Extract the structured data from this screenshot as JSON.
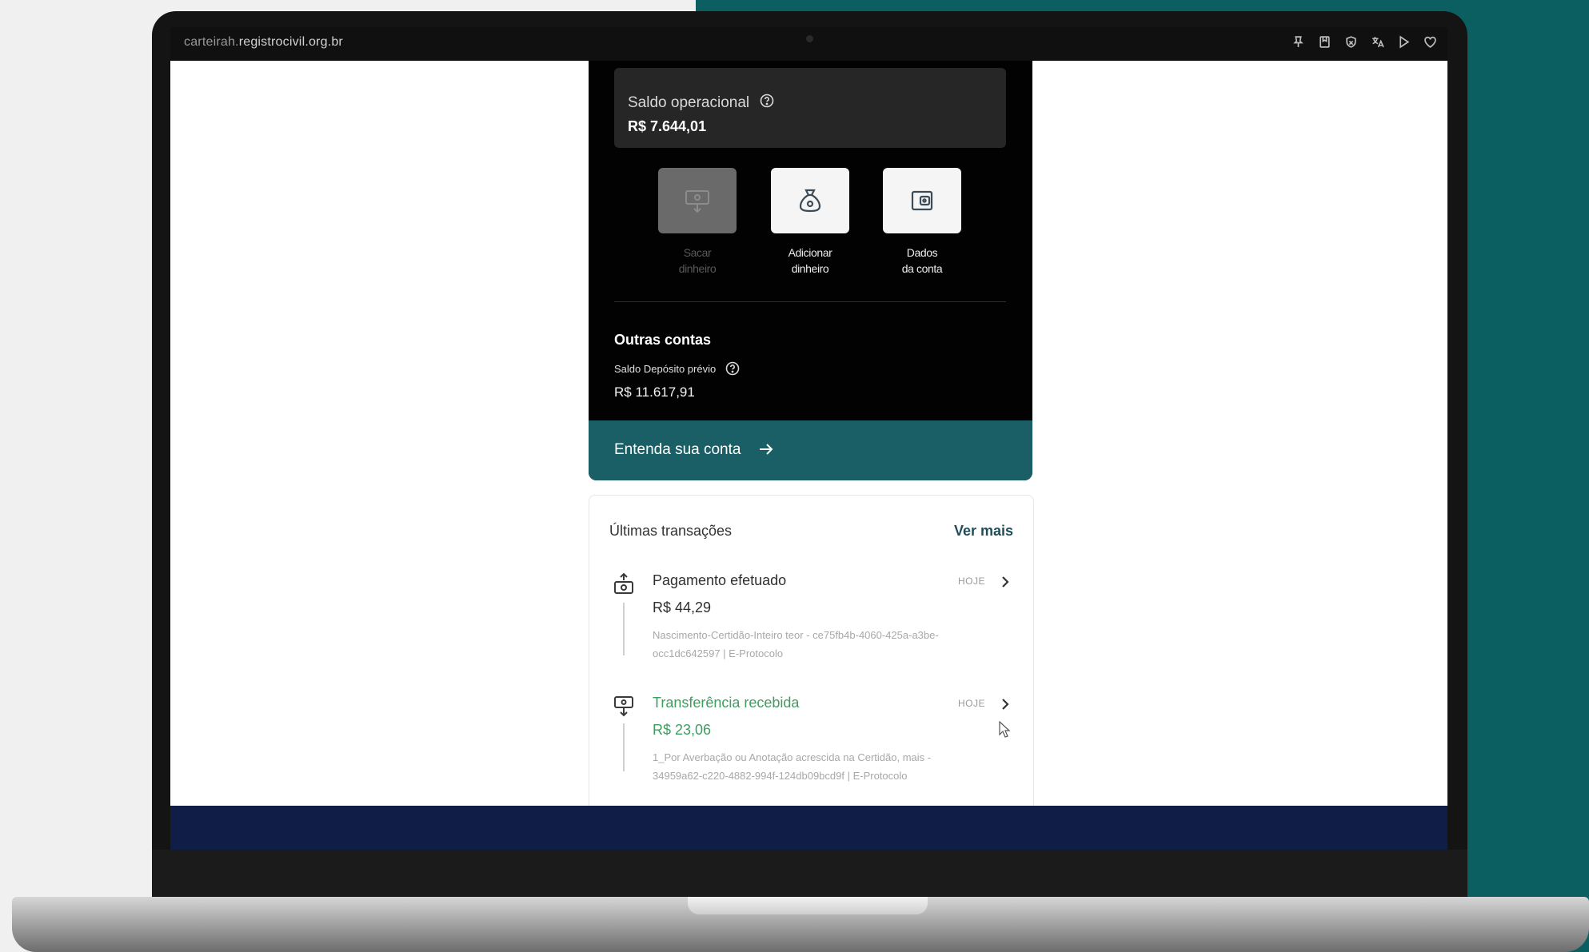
{
  "browser": {
    "url_prefix": "carteirah.",
    "url_host": "registrocivil.org.br",
    "icons": [
      "pin-icon",
      "bookmark-icon",
      "shield-icon",
      "translate-icon",
      "play-icon",
      "heart-icon"
    ]
  },
  "balance": {
    "label": "Saldo operacional",
    "value": "R$ 7.644,01"
  },
  "actions": [
    {
      "line1": "Sacar",
      "line2": "dinheiro",
      "enabled": false,
      "icon": "withdraw-icon"
    },
    {
      "line1": "Adicionar",
      "line2": "dinheiro",
      "enabled": true,
      "icon": "money-bag-icon"
    },
    {
      "line1": "Dados",
      "line2": "da conta",
      "enabled": true,
      "icon": "wallet-icon"
    }
  ],
  "other_accounts": {
    "title": "Outras contas",
    "deposit_label": "Saldo Depósito prévio",
    "deposit_value": "R$ 11.617,91"
  },
  "understand": {
    "label": "Entenda sua conta"
  },
  "transactions": {
    "title": "Últimas transações",
    "see_more": "Ver mais",
    "items": [
      {
        "name": "Pagamento efetuado",
        "amount": "R$ 44,29",
        "description": "Nascimento-Certidão-Inteiro teor - ce75fb4b-4060-425a-a3be-occ1dc642597 | E-Protocolo",
        "date": "HOJE",
        "type": "payment"
      },
      {
        "name": "Transferência recebida",
        "amount": "R$ 23,06",
        "description": "1_Por Averbação ou Anotação acrescida na Certidão, mais - 34959a62-c220-4882-994f-124db09bcd9f | E-Protocolo",
        "date": "HOJE",
        "type": "received"
      }
    ]
  },
  "colors": {
    "accent_teal": "#1a5f65",
    "received_green": "#3f9d5f",
    "dark_panel": "#020202",
    "footer_navy": "#0f1d47"
  }
}
